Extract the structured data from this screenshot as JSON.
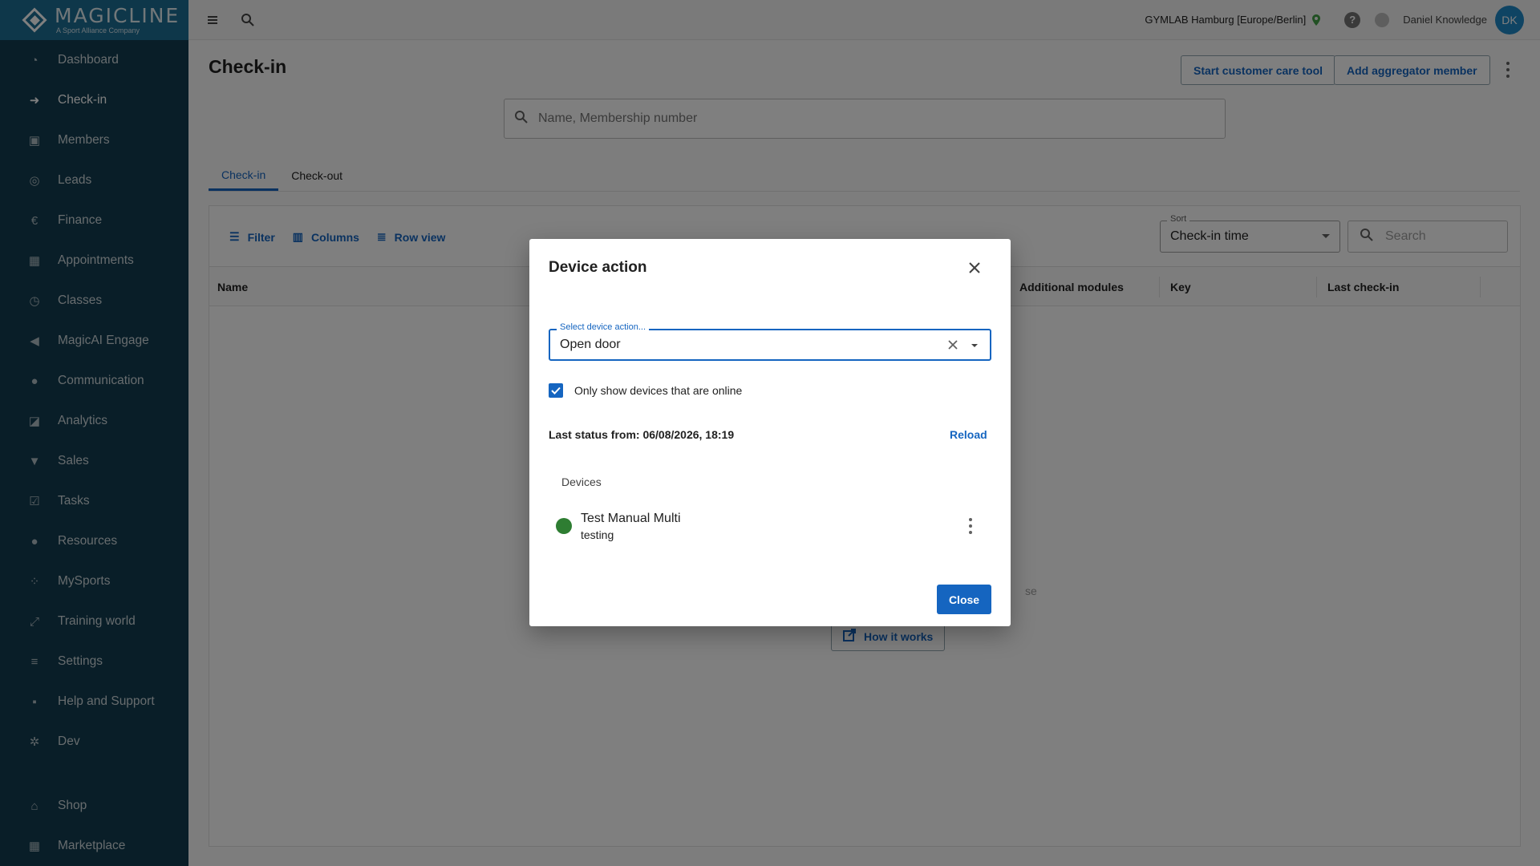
{
  "brand": {
    "name": "MAGICLINE",
    "tagline": "A Sport Alliance Company"
  },
  "sidebar": {
    "items": [
      {
        "label": "Dashboard",
        "icon": "gauge-icon"
      },
      {
        "label": "Check-in",
        "icon": "login-icon",
        "active": true
      },
      {
        "label": "Members",
        "icon": "badge-icon"
      },
      {
        "label": "Leads",
        "icon": "target-icon"
      },
      {
        "label": "Finance",
        "icon": "coin-icon"
      },
      {
        "label": "Appointments",
        "icon": "calendar-icon"
      },
      {
        "label": "Classes",
        "icon": "stopwatch-icon"
      },
      {
        "label": "MagicAI Engage",
        "icon": "megaphone-icon"
      },
      {
        "label": "Communication",
        "icon": "chat-icon"
      },
      {
        "label": "Analytics",
        "icon": "chart-icon"
      },
      {
        "label": "Sales",
        "icon": "cart-icon"
      },
      {
        "label": "Tasks",
        "icon": "checkbox-icon"
      },
      {
        "label": "Resources",
        "icon": "group-icon"
      },
      {
        "label": "MySports",
        "icon": "dots-grid-icon"
      },
      {
        "label": "Training world",
        "icon": "dumbbell-icon"
      },
      {
        "label": "Settings",
        "icon": "sliders-icon"
      },
      {
        "label": "Help and Support",
        "icon": "help-chat-icon"
      },
      {
        "label": "Dev",
        "icon": "gear-icon"
      }
    ],
    "bottom_items": [
      {
        "label": "Shop",
        "icon": "shop-icon"
      },
      {
        "label": "Marketplace",
        "icon": "apps-icon"
      }
    ]
  },
  "topbar": {
    "studio": "GYMLAB Hamburg [Europe/Berlin]",
    "user": "Daniel Knowledge",
    "initials": "DK"
  },
  "page": {
    "title": "Check-in",
    "care_button": "Start customer care tool",
    "aggregator_button": "Add aggregator member",
    "search_placeholder": "Name, Membership number",
    "tabs": [
      "Check-in",
      "Check-out"
    ],
    "toolbar": {
      "filter": "Filter",
      "columns": "Columns",
      "row_view": "Row view"
    },
    "sort": {
      "label": "Sort",
      "value": "Check-in time"
    },
    "table_search_placeholder": "Search",
    "columns": [
      "Name",
      "Additional modules",
      "Key",
      "Last check-in"
    ],
    "empty_partial": "se",
    "how_it_works": "How it works"
  },
  "modal": {
    "title": "Device action",
    "action_label": "Select device action...",
    "action_value": "Open door",
    "online_only_label": "Only show devices that are online",
    "online_only_checked": true,
    "last_status": "Last status from: 06/08/2026, 18:19",
    "reload": "Reload",
    "devices_heading": "Devices",
    "devices": [
      {
        "name": "Test Manual Multi",
        "sub": "testing",
        "status_color": "#2e7d32"
      }
    ],
    "close_label": "Close"
  },
  "colors": {
    "sidebar": "#123c50",
    "logo_bar": "#1d6f95",
    "accent": "#1565c0",
    "online": "#2e7d32"
  }
}
